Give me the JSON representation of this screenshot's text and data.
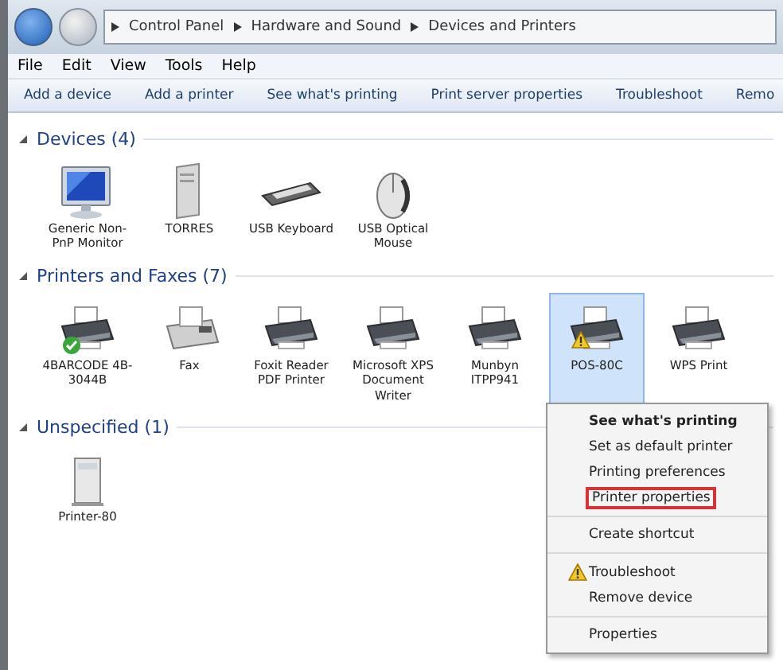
{
  "breadcrumbs": [
    "Control Panel",
    "Hardware and Sound",
    "Devices and Printers"
  ],
  "menu": [
    "File",
    "Edit",
    "View",
    "Tools",
    "Help"
  ],
  "commands": [
    "Add a device",
    "Add a printer",
    "See what's printing",
    "Print server properties",
    "Troubleshoot",
    "Remo"
  ],
  "groups": [
    {
      "title": "Devices (4)",
      "expanded": true,
      "items": [
        {
          "label": "Generic Non-PnP Monitor",
          "kind": "monitor",
          "selected": false,
          "default": false,
          "warning": false
        },
        {
          "label": "TORRES",
          "kind": "tower",
          "selected": false,
          "default": false,
          "warning": false
        },
        {
          "label": "USB Keyboard",
          "kind": "keyboard",
          "selected": false,
          "default": false,
          "warning": false
        },
        {
          "label": "USB Optical Mouse",
          "kind": "mouse",
          "selected": false,
          "default": false,
          "warning": false
        }
      ]
    },
    {
      "title": "Printers and Faxes (7)",
      "expanded": true,
      "items": [
        {
          "label": "4BARCODE 4B-3044B",
          "kind": "printer",
          "selected": false,
          "default": true,
          "warning": false
        },
        {
          "label": "Fax",
          "kind": "fax",
          "selected": false,
          "default": false,
          "warning": false
        },
        {
          "label": "Foxit Reader PDF Printer",
          "kind": "printer",
          "selected": false,
          "default": false,
          "warning": false
        },
        {
          "label": "Microsoft XPS Document Writer",
          "kind": "printer",
          "selected": false,
          "default": false,
          "warning": false
        },
        {
          "label": "Munbyn ITPP941",
          "kind": "printer",
          "selected": false,
          "default": false,
          "warning": false
        },
        {
          "label": "POS-80C",
          "kind": "printer",
          "selected": true,
          "default": false,
          "warning": true
        },
        {
          "label": "WPS Print",
          "kind": "printer",
          "selected": false,
          "default": false,
          "warning": false
        }
      ]
    },
    {
      "title": "Unspecified (1)",
      "expanded": true,
      "items": [
        {
          "label": "Printer-80",
          "kind": "server",
          "selected": false,
          "default": false,
          "warning": false
        }
      ]
    }
  ],
  "context_menu": [
    {
      "label": "See what's printing",
      "bold": true,
      "highlighted": false,
      "warning": false,
      "separator_before": false
    },
    {
      "label": "Set as default printer",
      "bold": false,
      "highlighted": false,
      "warning": false,
      "separator_before": false
    },
    {
      "label": "Printing preferences",
      "bold": false,
      "highlighted": false,
      "warning": false,
      "separator_before": false
    },
    {
      "label": "Printer properties",
      "bold": false,
      "highlighted": true,
      "warning": false,
      "separator_before": false
    },
    {
      "label": "Create shortcut",
      "bold": false,
      "highlighted": false,
      "warning": false,
      "separator_before": true
    },
    {
      "label": "Troubleshoot",
      "bold": false,
      "highlighted": false,
      "warning": true,
      "separator_before": true
    },
    {
      "label": "Remove device",
      "bold": false,
      "highlighted": false,
      "warning": false,
      "separator_before": false
    },
    {
      "label": "Properties",
      "bold": false,
      "highlighted": false,
      "warning": false,
      "separator_before": true
    }
  ]
}
